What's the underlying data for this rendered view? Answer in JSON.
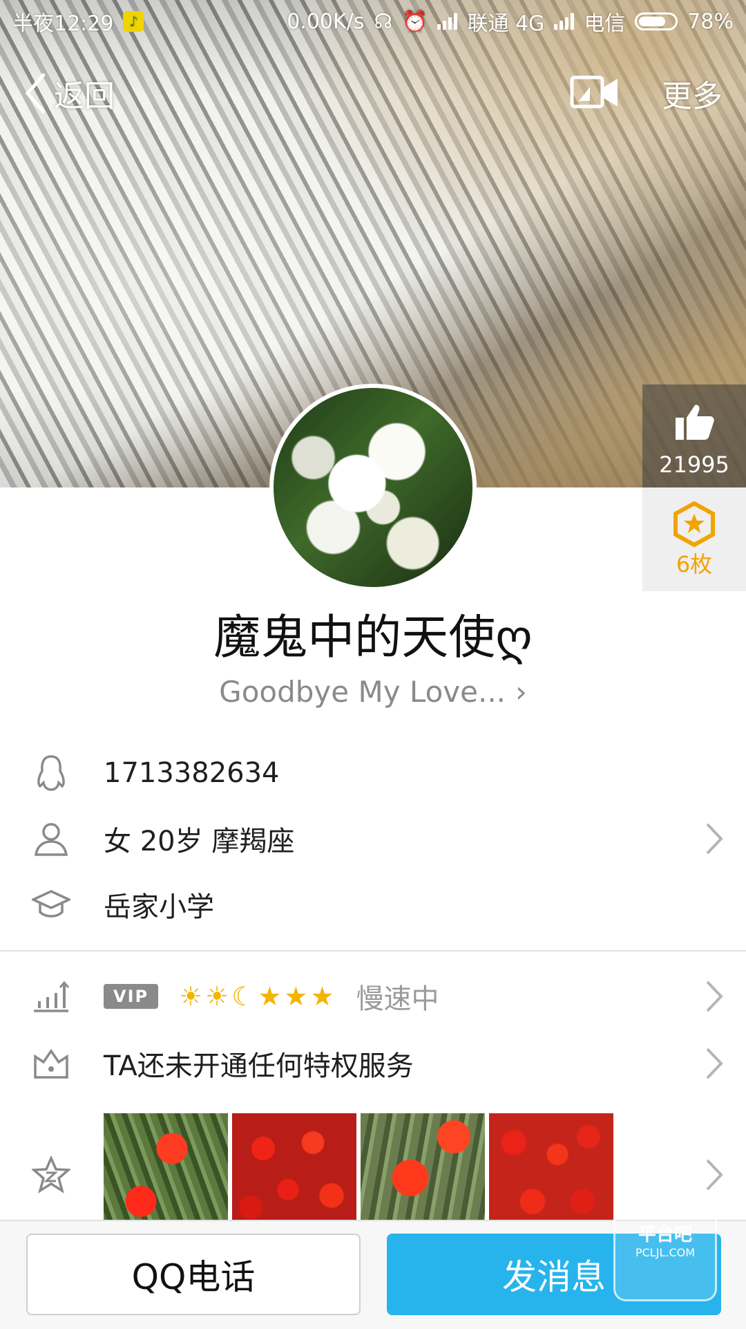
{
  "status_bar": {
    "time": "半夜12:29",
    "net_speed": "0.00K/s",
    "carrier1": "联通 4G",
    "carrier2": "电信",
    "battery": "78%"
  },
  "nav": {
    "back_label": "返回",
    "more_label": "更多"
  },
  "likes": {
    "count": "21995"
  },
  "medals": {
    "count": "6枚"
  },
  "profile": {
    "nickname": "魔鬼中的天使ღ",
    "signature": "Goodbye  My  Love...",
    "qq_number": "1713382634",
    "basic_info": "女  20岁  摩羯座",
    "school": "岳家小学"
  },
  "vip": {
    "tag": "VIP",
    "level_icons": [
      "sun-icon",
      "sun-icon",
      "moon-icon",
      "star-icon",
      "star-icon",
      "star-icon"
    ],
    "status": "慢速中"
  },
  "privilege": {
    "text": "TA还未开通任何特权服务"
  },
  "bottom": {
    "call_label": "QQ电话",
    "message_label": "发消息"
  },
  "watermark": {
    "line1": "平台吧",
    "line2": "PCLJL.COM"
  },
  "colors": {
    "accent": "#27b4ec",
    "medal": "#f2a300"
  }
}
